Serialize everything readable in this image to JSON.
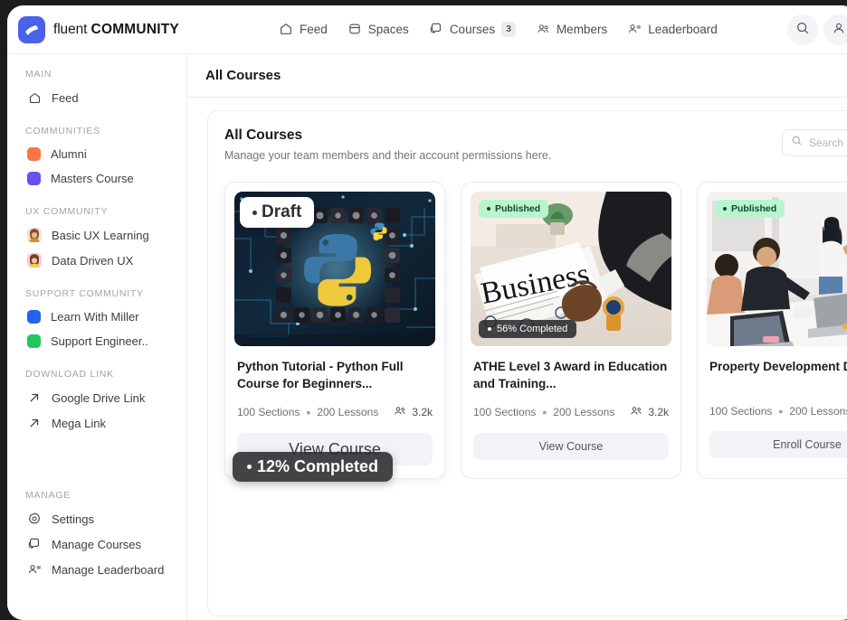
{
  "brand": {
    "word1": "fluent",
    "word2": "COMMUNITY"
  },
  "topnav": {
    "items": [
      {
        "label": "Feed",
        "icon": "home-icon",
        "badge": null
      },
      {
        "label": "Spaces",
        "icon": "spaces-icon",
        "badge": null
      },
      {
        "label": "Courses",
        "icon": "courses-icon",
        "badge": "3"
      },
      {
        "label": "Members",
        "icon": "members-icon",
        "badge": null
      },
      {
        "label": "Leaderboard",
        "icon": "leaderboard-icon",
        "badge": null
      }
    ],
    "search_icon": "search-icon"
  },
  "sidebar": {
    "groups": [
      {
        "title": "MAIN",
        "items": [
          {
            "label": "Feed",
            "icon": "home-icon",
            "marker": "icon"
          }
        ]
      },
      {
        "title": "COMMUNITIES",
        "items": [
          {
            "label": "Alumni",
            "marker": "square",
            "color": "#f97643"
          },
          {
            "label": "Masters Course",
            "marker": "square",
            "color": "#6b4ef0"
          }
        ]
      },
      {
        "title": "UX COMMUNITY",
        "items": [
          {
            "label": "Basic UX Learning",
            "marker": "avatar",
            "color": "#c98a5e"
          },
          {
            "label": "Data Driven UX",
            "marker": "avatar",
            "color": "#e9a0a8"
          }
        ]
      },
      {
        "title": "SUPPORT COMMUNITY",
        "items": [
          {
            "label": "Learn With Miller",
            "marker": "square",
            "color": "#2563eb"
          },
          {
            "label": "Support Engineer..",
            "marker": "square",
            "color": "#22c55e"
          }
        ]
      },
      {
        "title": "DOWNLOAD LINK",
        "items": [
          {
            "label": "Google Drive Link",
            "marker": "icon",
            "icon": "external-link-icon"
          },
          {
            "label": "Mega Link",
            "marker": "icon",
            "icon": "external-link-icon"
          }
        ]
      },
      {
        "title": "MANAGE",
        "items": [
          {
            "label": "Settings",
            "marker": "icon",
            "icon": "gear-icon"
          },
          {
            "label": "Manage Courses",
            "marker": "icon",
            "icon": "courses-icon"
          },
          {
            "label": "Manage Leaderboard",
            "marker": "icon",
            "icon": "leaderboard-icon"
          }
        ]
      }
    ]
  },
  "main": {
    "header_title": "All Courses",
    "panel_title": "All Courses",
    "panel_subtitle": "Manage your team members and their account permissions here.",
    "search": {
      "placeholder": "Search courses",
      "value": ""
    }
  },
  "courses": [
    {
      "status": "Draft",
      "status_type": "draft",
      "progress": "12% Completed",
      "title": "Python Tutorial - Python Full Course for Beginners...",
      "sections": "100 Sections",
      "lessons": "200 Lessons",
      "students": "3.2k",
      "cta": "View Course",
      "thumb": "python-course-thumbnail"
    },
    {
      "status": "Published",
      "status_type": "published",
      "progress": "56% Completed",
      "title": "ATHE Level 3 Award in Education and Training...",
      "sections": "100 Sections",
      "lessons": "200 Lessons",
      "students": "3.2k",
      "cta": "View Course",
      "thumb": "business-newspaper-thumbnail"
    },
    {
      "status": "Published",
      "status_type": "published",
      "progress": "",
      "title": "Property Development Dip...",
      "sections": "100 Sections",
      "lessons": "200 Lessons",
      "students": "",
      "cta": "Enroll Course",
      "thumb": "office-meeting-thumbnail"
    }
  ],
  "colors": {
    "brand": "#4a62e8",
    "published_badge": "#b8f5cf",
    "page_bg": "#ffffff"
  }
}
